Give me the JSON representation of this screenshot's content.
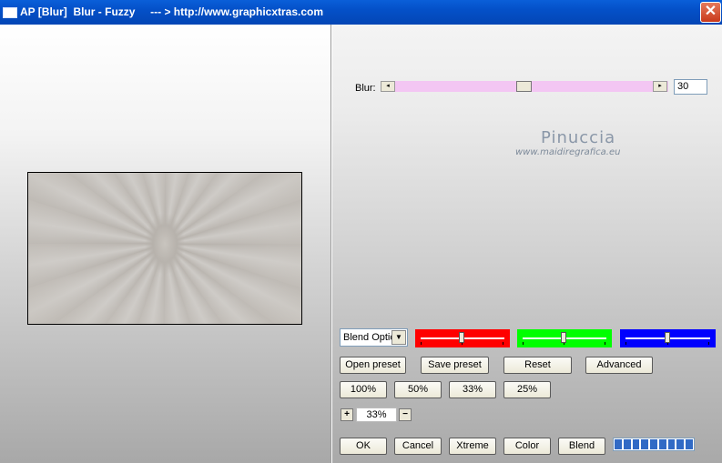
{
  "window": {
    "title": "AP [Blur]  Blur - Fuzzy     --- > http://www.graphicxtras.com",
    "close_glyph": "✕"
  },
  "blur": {
    "label": "Blur:",
    "value": "30",
    "left_arrow": "◂",
    "right_arrow": "▸"
  },
  "watermark": {
    "line1": "Pinuccia",
    "line2": "www.maidiregrafica.eu"
  },
  "blend": {
    "selected": "Blend Optio",
    "arrow": "▼"
  },
  "color_sliders": [
    {
      "name": "red",
      "color": "#ff0000"
    },
    {
      "name": "green",
      "color": "#00ff00"
    },
    {
      "name": "blue",
      "color": "#0000ff"
    }
  ],
  "preset_buttons": {
    "open": "Open preset",
    "save": "Save preset",
    "reset": "Reset",
    "advanced": "Advanced"
  },
  "zoom_buttons": [
    "100%",
    "50%",
    "33%",
    "25%"
  ],
  "zoom": {
    "plus": "+",
    "minus": "−",
    "value": "33%"
  },
  "bottom_buttons": {
    "ok": "OK",
    "cancel": "Cancel",
    "xtreme": "Xtreme",
    "color": "Color",
    "blend": "Blend"
  },
  "progress": {
    "filled": 1.0,
    "segments": 9
  }
}
